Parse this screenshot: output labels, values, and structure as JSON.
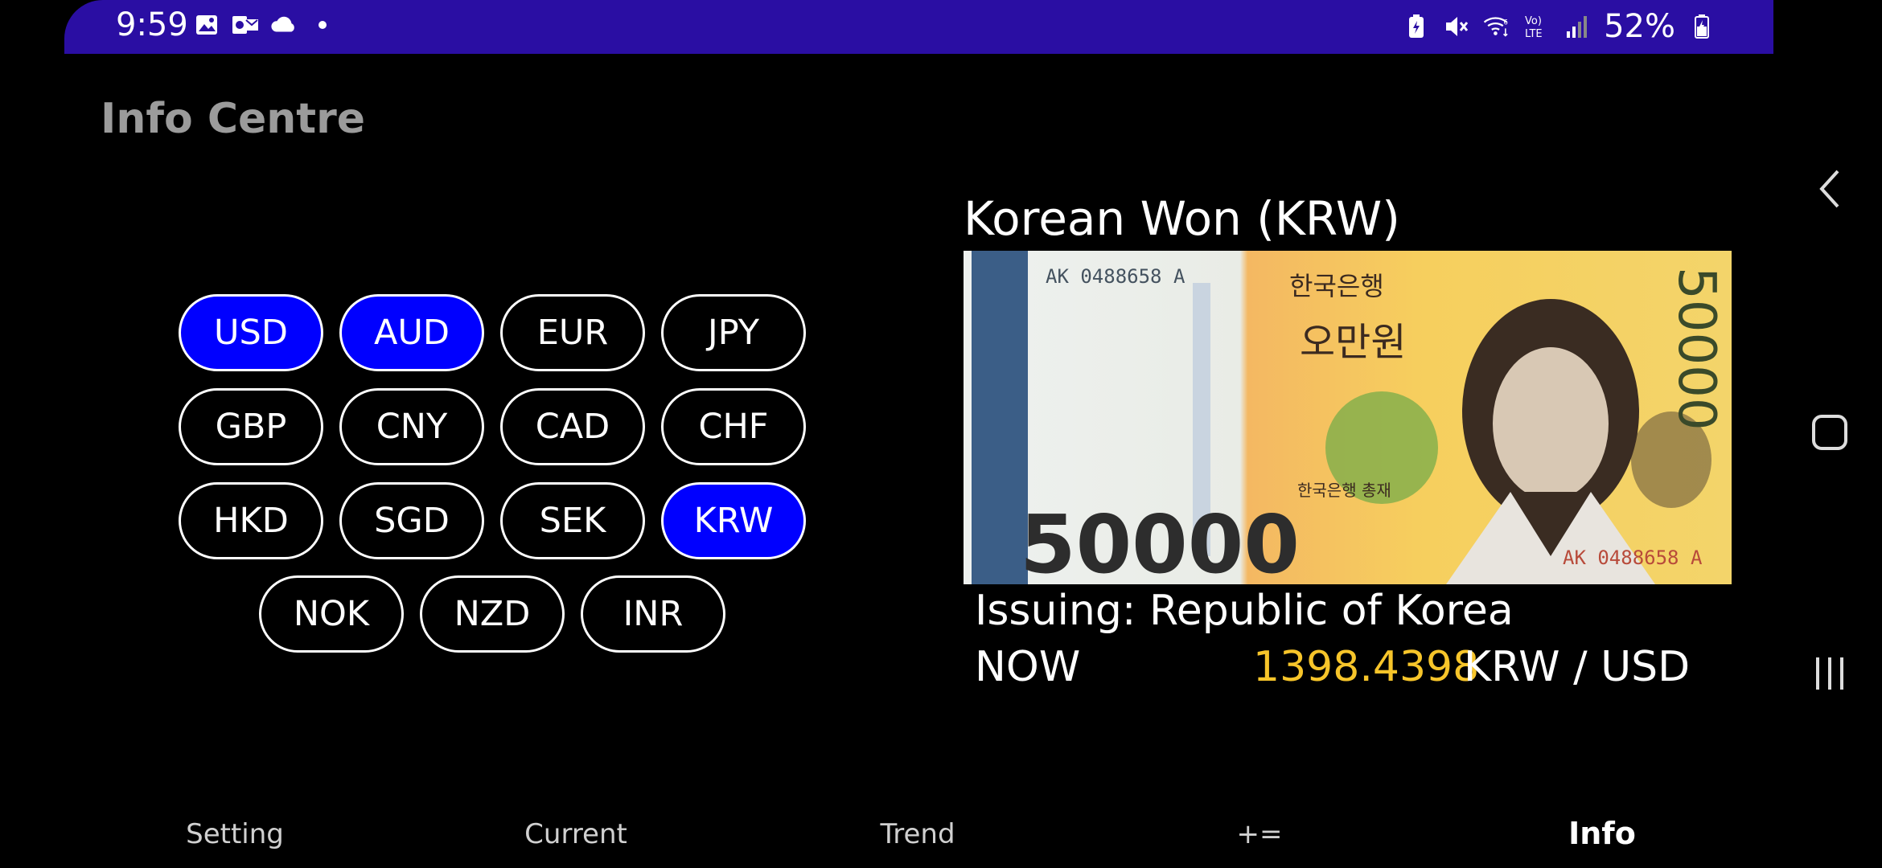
{
  "status_bar": {
    "time": "9:59",
    "battery": "52%",
    "left_icons": [
      "image-icon",
      "outlook-icon",
      "cloud-icon",
      "dot-icon"
    ],
    "right_icons": [
      "battery-saver-icon",
      "mute-icon",
      "wifi-icon",
      "volte-icon",
      "signal-icon",
      "battery-icon"
    ]
  },
  "app": {
    "title": "Info Centre"
  },
  "currencies": [
    {
      "code": "USD",
      "selected": true
    },
    {
      "code": "AUD",
      "selected": true
    },
    {
      "code": "EUR",
      "selected": false
    },
    {
      "code": "JPY",
      "selected": false
    },
    {
      "code": "GBP",
      "selected": false
    },
    {
      "code": "CNY",
      "selected": false
    },
    {
      "code": "CAD",
      "selected": false
    },
    {
      "code": "CHF",
      "selected": false
    },
    {
      "code": "HKD",
      "selected": false
    },
    {
      "code": "SGD",
      "selected": false
    },
    {
      "code": "SEK",
      "selected": false
    },
    {
      "code": "KRW",
      "selected": true
    },
    {
      "code": "NOK",
      "selected": false
    },
    {
      "code": "NZD",
      "selected": false
    },
    {
      "code": "INR",
      "selected": false
    }
  ],
  "detail": {
    "title": "Korean Won (KRW)",
    "issuing": "Issuing: Republic of Korea",
    "now_label": "NOW",
    "rate": "1398.4398",
    "unit": "KRW / USD",
    "banknote": {
      "serial": "AK 0488658 A",
      "denomination": "50000",
      "bank_name": "한국은행",
      "value_text": "오만원",
      "governor_text": "한국은행 총재"
    }
  },
  "bottom_nav": {
    "items": [
      "Setting",
      "Current",
      "Trend",
      "+=",
      "Info"
    ],
    "active": "Info"
  },
  "colors": {
    "status_bar": "#2a0ea3",
    "selected_button": "#0000ff",
    "rate_highlight": "#f7c52a"
  }
}
